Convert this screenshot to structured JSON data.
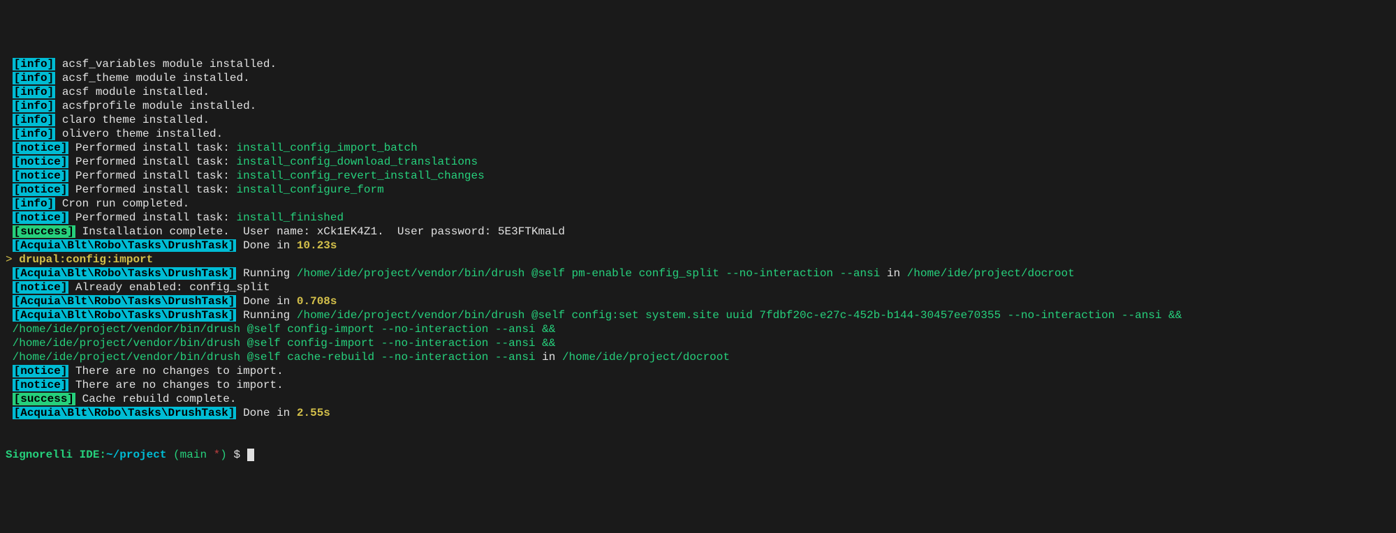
{
  "lines": [
    {
      "tag": "info",
      "parts": [
        {
          "c": "white",
          "t": " acsf_variables module installed."
        }
      ]
    },
    {
      "tag": "info",
      "parts": [
        {
          "c": "white",
          "t": " acsf_theme module installed."
        }
      ]
    },
    {
      "tag": "info",
      "parts": [
        {
          "c": "white",
          "t": " acsf module installed."
        }
      ]
    },
    {
      "tag": "info",
      "parts": [
        {
          "c": "white",
          "t": " acsfprofile module installed."
        }
      ]
    },
    {
      "tag": "info",
      "parts": [
        {
          "c": "white",
          "t": " claro theme installed."
        }
      ]
    },
    {
      "tag": "info",
      "parts": [
        {
          "c": "white",
          "t": " olivero theme installed."
        }
      ]
    },
    {
      "tag": "notice",
      "parts": [
        {
          "c": "white",
          "t": " Performed install task: "
        },
        {
          "c": "green",
          "t": "install_config_import_batch"
        }
      ]
    },
    {
      "tag": "notice",
      "parts": [
        {
          "c": "white",
          "t": " Performed install task: "
        },
        {
          "c": "green",
          "t": "install_config_download_translations"
        }
      ]
    },
    {
      "tag": "notice",
      "parts": [
        {
          "c": "white",
          "t": " Performed install task: "
        },
        {
          "c": "green",
          "t": "install_config_revert_install_changes"
        }
      ]
    },
    {
      "tag": "notice",
      "parts": [
        {
          "c": "white",
          "t": " Performed install task: "
        },
        {
          "c": "green",
          "t": "install_configure_form"
        }
      ]
    },
    {
      "tag": "info",
      "parts": [
        {
          "c": "white",
          "t": " Cron run completed."
        }
      ]
    },
    {
      "tag": "notice",
      "parts": [
        {
          "c": "white",
          "t": " Performed install task: "
        },
        {
          "c": "green",
          "t": "install_finished"
        }
      ]
    },
    {
      "tag": "success",
      "parts": [
        {
          "c": "white",
          "t": " Installation complete.  User name: xCk1EK4Z1.  User password: 5E3FTKmaLd"
        }
      ]
    },
    {
      "tag": "task",
      "parts": [
        {
          "c": "white",
          "t": " Done in "
        },
        {
          "c": "yellow",
          "t": "10.23s"
        }
      ]
    },
    {
      "tag": null,
      "parts": [
        {
          "c": "prompt-gt",
          "t": ">"
        },
        {
          "c": "yellow",
          "t": " drupal:config:import"
        }
      ]
    },
    {
      "tag": "task",
      "parts": [
        {
          "c": "white",
          "t": " Running "
        },
        {
          "c": "green",
          "t": "/home/ide/project/vendor/bin/drush @self pm-enable config_split --no-interaction --ansi"
        },
        {
          "c": "white",
          "t": " in "
        },
        {
          "c": "green",
          "t": "/home/ide/project/docroot"
        }
      ]
    },
    {
      "tag": "notice",
      "parts": [
        {
          "c": "white",
          "t": " Already enabled: config_split"
        }
      ]
    },
    {
      "tag": "task",
      "parts": [
        {
          "c": "white",
          "t": " Done in "
        },
        {
          "c": "yellow",
          "t": "0.708s"
        }
      ]
    },
    {
      "tag": "task",
      "parts": [
        {
          "c": "white",
          "t": " Running "
        },
        {
          "c": "green",
          "t": "/home/ide/project/vendor/bin/drush @self config:set system.site uuid 7fdbf20c-e27c-452b-b144-30457ee70355 --no-interaction --ansi &&"
        }
      ]
    },
    {
      "tag": null,
      "parts": [
        {
          "c": "green",
          "t": " /home/ide/project/vendor/bin/drush @self config-import --no-interaction --ansi &&"
        }
      ]
    },
    {
      "tag": null,
      "parts": [
        {
          "c": "green",
          "t": " /home/ide/project/vendor/bin/drush @self config-import --no-interaction --ansi &&"
        }
      ]
    },
    {
      "tag": null,
      "parts": [
        {
          "c": "green",
          "t": " /home/ide/project/vendor/bin/drush @self cache-rebuild --no-interaction --ansi"
        },
        {
          "c": "white",
          "t": " in "
        },
        {
          "c": "green",
          "t": "/home/ide/project/docroot"
        }
      ]
    },
    {
      "tag": "notice",
      "parts": [
        {
          "c": "white",
          "t": " There are no changes to import."
        }
      ]
    },
    {
      "tag": "notice",
      "parts": [
        {
          "c": "white",
          "t": " There are no changes to import."
        }
      ]
    },
    {
      "tag": "success",
      "parts": [
        {
          "c": "white",
          "t": " Cache rebuild complete."
        }
      ]
    },
    {
      "tag": "task",
      "parts": [
        {
          "c": "white",
          "t": " Done in "
        },
        {
          "c": "yellow",
          "t": "2.55s"
        }
      ]
    }
  ],
  "tags": {
    "info": "[info]",
    "notice": "[notice]",
    "success": "[success]",
    "task": "[Acquia\\Blt\\Robo\\Tasks\\DrushTask]"
  },
  "prompt": {
    "host": "Signorelli IDE",
    "sep": ":",
    "path": "~/project",
    "branch_open": " (",
    "branch": "main",
    "star": " *",
    "branch_close": ")",
    "dollar": " $ "
  }
}
